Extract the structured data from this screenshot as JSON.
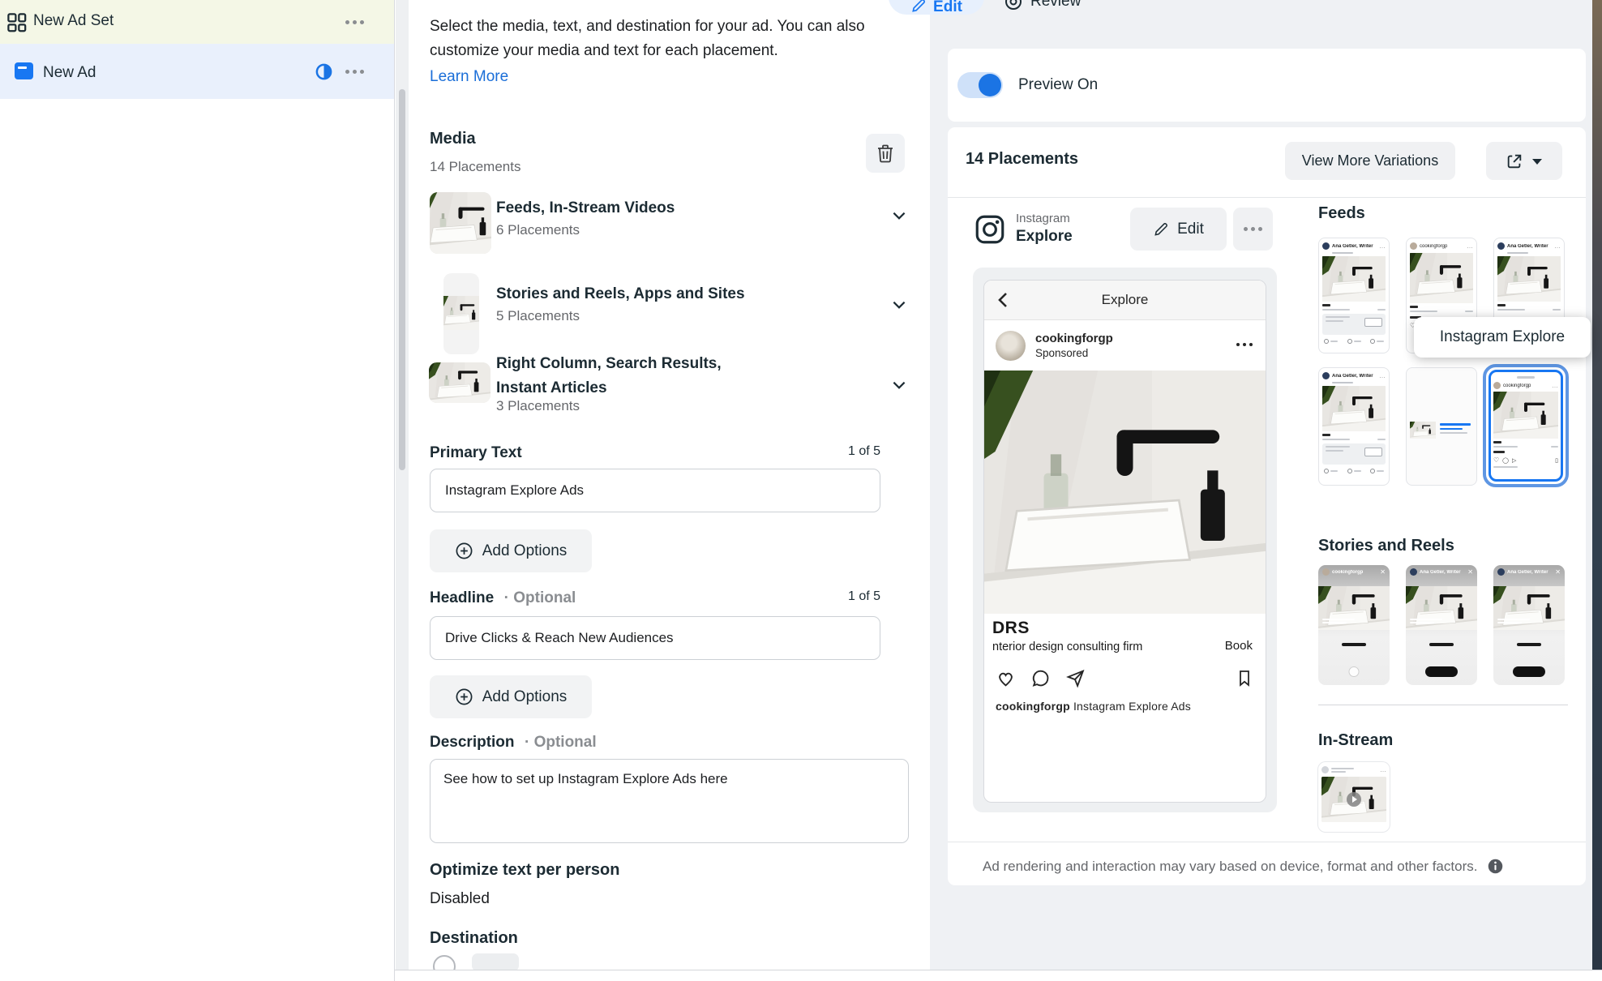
{
  "topbar": {
    "edit": "Edit",
    "review": "Review"
  },
  "sidebar": {
    "ad_set": "New Ad Set",
    "ad": "New Ad"
  },
  "editor": {
    "intro": "Select the media, text, and destination for your ad. You can also customize your media and text for each placement.",
    "learn_more": "Learn More",
    "media": {
      "title": "Media",
      "subtitle": "14 Placements",
      "groups": [
        {
          "title": "Feeds, In-Stream Videos",
          "count": "6 Placements"
        },
        {
          "title": "Stories and Reels, Apps and Sites",
          "count": "5 Placements"
        },
        {
          "title": "Right Column, Search Results, Instant Articles",
          "count": "3 Placements"
        }
      ]
    },
    "primary_text": {
      "label": "Primary Text",
      "counter": "1 of 5",
      "value": "Instagram Explore Ads"
    },
    "headline": {
      "label": "Headline",
      "optional": "· Optional",
      "counter": "1 of 5",
      "value": "Drive Clicks & Reach New Audiences"
    },
    "description": {
      "label": "Description",
      "optional": "· Optional",
      "value": "See how to set up Instagram Explore Ads here"
    },
    "add_options": "Add Options",
    "optimize": {
      "label": "Optimize text per person",
      "value": "Disabled"
    },
    "destination_label": "Destination"
  },
  "preview": {
    "toggle_label": "Preview On",
    "placements_title": "14 Placements",
    "view_more": "View More Variations",
    "network": "Instagram",
    "format": "Explore",
    "edit": "Edit",
    "tooltip": "Instagram Explore",
    "sections": {
      "feeds": "Feeds",
      "stories": "Stories and Reels",
      "instream": "In-Stream"
    },
    "phone": {
      "nav_title": "Explore",
      "username": "cookingforgp",
      "sponsored": "Sponsored",
      "overlay_title": "DRS",
      "overlay_subtitle": "nterior design consulting firm",
      "cta": "Book",
      "caption_user": "cookingforgp",
      "caption_text": "Instagram Explore Ads"
    },
    "feed_thumbs": [
      {
        "name": "Ana Getler, Writer"
      },
      {
        "name": "cookingforgp"
      },
      {
        "name": "Ana Getler, Writer"
      },
      {
        "name": "Ana Getler, Writer"
      },
      {
        "name": ""
      },
      {
        "name": "cookingforgp"
      }
    ],
    "story_thumbs": [
      {
        "name": "cookingforgp"
      },
      {
        "name": "Ana Getler, Writer"
      },
      {
        "name": "Ana Getler, Writer"
      }
    ],
    "disclaimer": "Ad rendering and interaction may vary based on device, format and other factors.",
    "colors": {
      "accent_blue": "#1877f2",
      "toggle_blue": "#1b74e4",
      "selected_border": "#2e7ef0"
    }
  }
}
